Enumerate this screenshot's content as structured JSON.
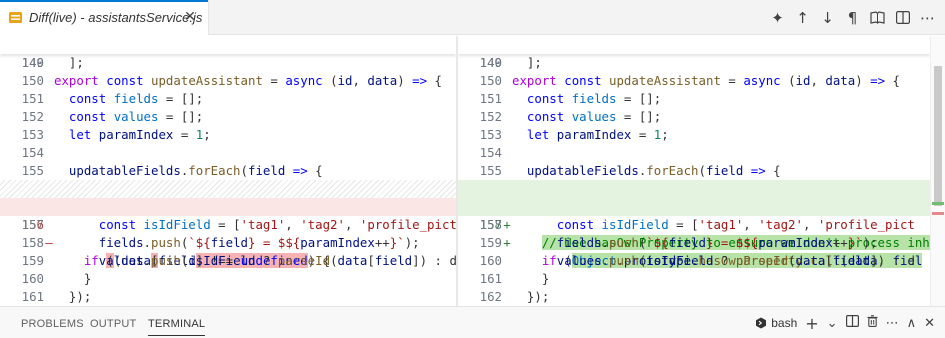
{
  "tab": {
    "title": "Diff(live) - assistantsService.js",
    "close": "✕"
  },
  "actions": [
    {
      "name": "sparkle-icon",
      "glyph": "✦"
    },
    {
      "name": "arrow-up-icon",
      "glyph": "↑"
    },
    {
      "name": "arrow-down-icon",
      "glyph": "↓"
    },
    {
      "name": "pilcrow-icon",
      "glyph": "¶"
    },
    {
      "name": "book-icon",
      "glyph": "🕮"
    },
    {
      "name": "split-editor-icon",
      "glyph": "◫"
    },
    {
      "name": "more-icon",
      "glyph": "⋯"
    }
  ],
  "left": {
    "sticky": {
      "num": "140",
      "code": "export const updateAssistant = async (id, data) => {"
    },
    "lines": [
      {
        "num": "149",
        "code": "  ];"
      },
      {
        "num": "150",
        "code": ""
      },
      {
        "num": "151",
        "code": "  const fields = [];"
      },
      {
        "num": "152",
        "code": "  const values = [];"
      },
      {
        "num": "153",
        "code": "  let paramIndex = 1;"
      },
      {
        "num": "154",
        "code": ""
      },
      {
        "num": "155",
        "code": "  updatableFields.forEach(field => {"
      },
      {
        "num": "",
        "code": ""
      },
      {
        "num": "156",
        "mark": "—",
        "code": "    if (data[field] !== undefined) {"
      },
      {
        "num": "157",
        "code": "      const isIdField = ['tag1', 'tag2', 'profile_pict"
      },
      {
        "num": "158",
        "code": "      fields.push(`${field} = $${paramIndex++}`);"
      },
      {
        "num": "159",
        "code": "      values.push(isIdField ? parseId(data[field]) : d"
      },
      {
        "num": "160",
        "code": "    }"
      },
      {
        "num": "161",
        "code": "  });"
      }
    ]
  },
  "right": {
    "sticky": {
      "num": "140",
      "code": "export const updateAssistant = async (id, data) => {"
    },
    "lines": [
      {
        "num": "149",
        "code": "  ];"
      },
      {
        "num": "150",
        "code": ""
      },
      {
        "num": "151",
        "code": "  const fields = [];"
      },
      {
        "num": "152",
        "code": "  const values = [];"
      },
      {
        "num": "153",
        "code": "  let paramIndex = 1;"
      },
      {
        "num": "154",
        "code": ""
      },
      {
        "num": "155",
        "code": "  updatableFields.forEach(field => {"
      },
      {
        "num": "156",
        "mark": "+",
        "code": "    // Use hasOwnProperty to ensure we don't process inh"
      },
      {
        "num": "157",
        "mark": "+",
        "code": "    if (Object.prototype.hasOwnProperty.call(data, fiel"
      },
      {
        "num": "158",
        "code": "      const isIdField = ['tag1', 'tag2', 'profile_pict"
      },
      {
        "num": "159",
        "code": "      fields.push(`${field} = $${paramIndex++}`);"
      },
      {
        "num": "160",
        "code": "      values.push(isIdField ? parseId(data[field]) : d"
      },
      {
        "num": "161",
        "code": "    }"
      },
      {
        "num": "162",
        "code": "  });"
      }
    ]
  },
  "panel": {
    "tabs": [
      "PROBLEMS",
      "OUTPUT",
      "TERMINAL"
    ],
    "active_tab": "TERMINAL",
    "shell": "bash",
    "icons": [
      "+",
      "⌄",
      "◫",
      "🗑",
      "⋯",
      "∧",
      "✕"
    ]
  },
  "colors": {
    "accent": "#0078d4",
    "deleted": "#fbe6e6",
    "added": "#e3f3df"
  }
}
